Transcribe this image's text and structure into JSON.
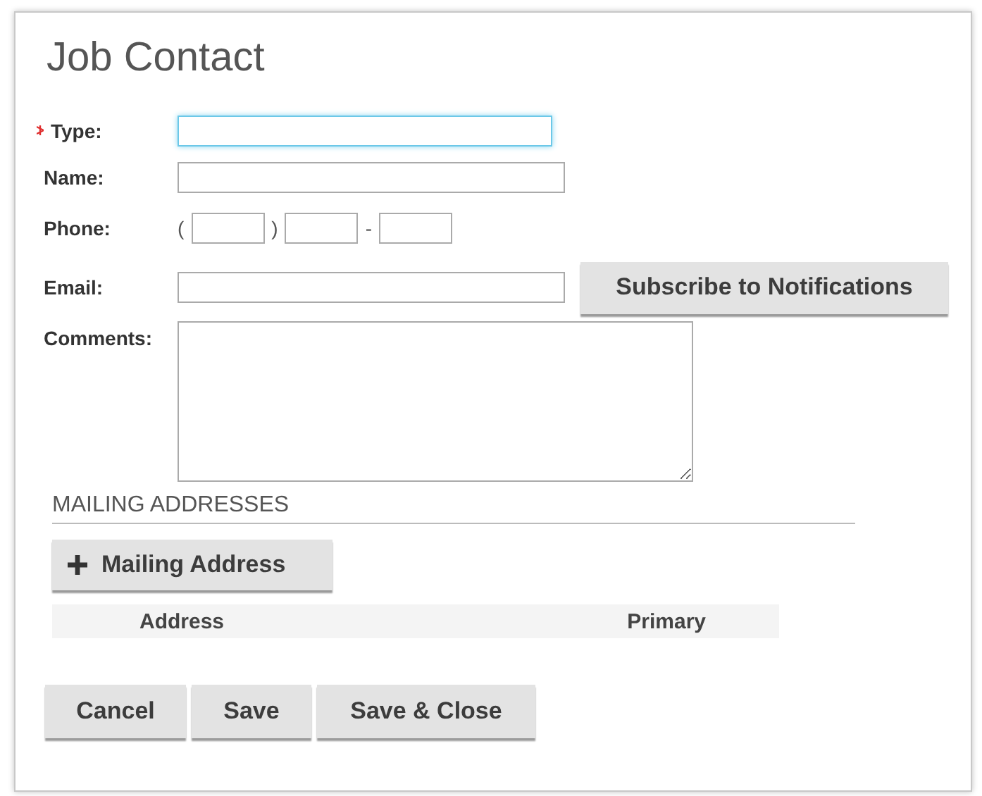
{
  "dialog": {
    "title": "Job Contact"
  },
  "fields": [
    {
      "kind": "text",
      "label": "Type:",
      "required": true,
      "focused": true
    },
    {
      "kind": "text",
      "label": "Name:",
      "required": false,
      "focused": false
    },
    {
      "kind": "phone",
      "label": "Phone:",
      "required": false,
      "focused": false,
      "open_paren": "(",
      "close_paren": ")",
      "dash": "-"
    },
    {
      "kind": "text",
      "label": "Email:",
      "required": false,
      "focused": false,
      "button": "Subscribe to Notifications"
    },
    {
      "kind": "textarea",
      "label": "Comments:",
      "required": false,
      "focused": false
    }
  ],
  "mailing": {
    "heading": "MAILING ADDRESSES",
    "add_button": "Mailing Address",
    "columns": [
      "Address",
      "Primary"
    ]
  },
  "buttons": [
    "Cancel",
    "Save",
    "Save & Close"
  ]
}
